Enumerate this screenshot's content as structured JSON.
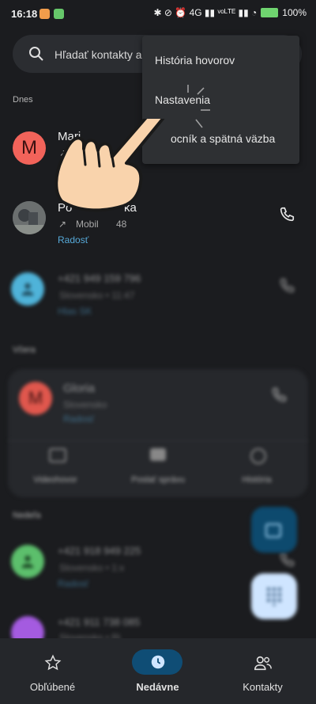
{
  "status_bar": {
    "time": "16:18",
    "indicators": "✱ ⊘ ⏰ 4G ▮▮ ᵛᵒᴸᵀᴱ ▮▮ ◔",
    "battery": "100%"
  },
  "search": {
    "placeholder": "Hľadať kontakty a"
  },
  "sections": {
    "today": "Dnes",
    "older": "Včera",
    "later": "Nedeľa"
  },
  "calls": [
    {
      "name": "Mari",
      "initial": "M",
      "avatar_color": "#f2635a",
      "tag": "R"
    },
    {
      "name": "Po",
      "name_end": "ka",
      "sub": "Mobil",
      "sub_end": "48",
      "tag": "Radosť"
    },
    {
      "name": "+421 949 159 796",
      "sub": "Slovensko • 11:47",
      "tag": "Hlas SK"
    }
  ],
  "expanded_call": {
    "name": "Gloria",
    "initial": "M",
    "sub": "Slovensko",
    "tag": "Radosť"
  },
  "expanded_actions": [
    "Videohovor",
    "Poslať správu",
    "História"
  ],
  "more_calls": [
    {
      "name": "+421 918 949 225",
      "sub": "Slovensko • 1:x",
      "tag": "Radosť"
    },
    {
      "name": "+421 911 738 085",
      "sub": "Slovensko • Ri"
    }
  ],
  "overflow_menu": {
    "items": [
      "História hovorov",
      "Nastavenia",
      "ocník a spätná väzba"
    ]
  },
  "bottom_nav": {
    "favorites": "Obľúbené",
    "recent": "Nedávne",
    "contacts": "Kontakty"
  },
  "colors": {
    "accent": "#0f4d75",
    "link": "#56a9d8",
    "menu_bg": "#2e3033"
  }
}
